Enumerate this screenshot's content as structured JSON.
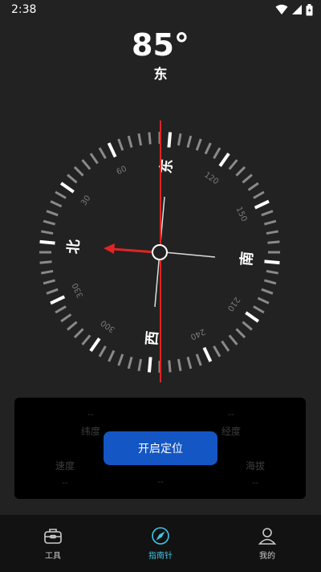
{
  "status": {
    "time": "2:38"
  },
  "heading": {
    "degrees": "85°",
    "direction": "东"
  },
  "compass": {
    "cardinals": {
      "north": "北",
      "east": "东",
      "south": "南",
      "west": "西"
    },
    "degree_labels": [
      "30",
      "60",
      "120",
      "150",
      "210",
      "240",
      "300",
      "330"
    ]
  },
  "info": {
    "latitude_label": "纬度",
    "latitude_value": "--",
    "longitude_label": "经度",
    "longitude_value": "--",
    "speed_label": "速度",
    "speed_value": "--",
    "center_value": "--",
    "altitude_label": "海拔",
    "altitude_value": "--"
  },
  "locate_button": {
    "label": "开启定位"
  },
  "nav": [
    {
      "label": "工具",
      "icon": "toolbox-icon"
    },
    {
      "label": "指南针",
      "icon": "compass-icon"
    },
    {
      "label": "我的",
      "icon": "user-icon"
    }
  ],
  "colors": {
    "accent": "#3ec6e6",
    "button": "#1456c4",
    "needle": "#e02424"
  }
}
